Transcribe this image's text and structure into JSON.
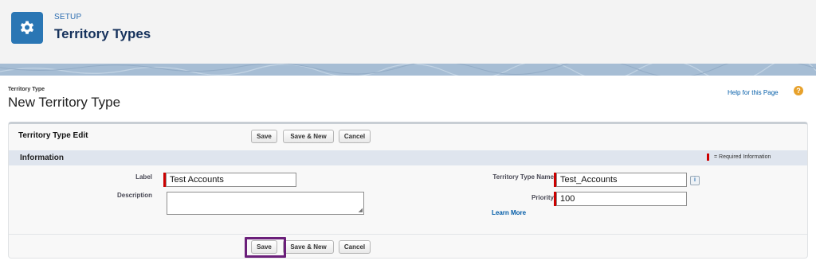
{
  "header": {
    "eyebrow": "SETUP",
    "title": "Territory Types",
    "icon": "gear-icon",
    "accent_color": "#2a76b4"
  },
  "page": {
    "type_label": "Territory Type",
    "title": "New Territory Type",
    "help_link": "Help for this Page",
    "help_icon": "question-icon"
  },
  "edit_block": {
    "title": "Territory Type Edit",
    "buttons": {
      "save": "Save",
      "save_new": "Save & New",
      "cancel": "Cancel"
    }
  },
  "section": {
    "title": "Information",
    "required_legend": "= Required Information"
  },
  "fields": {
    "label": {
      "label": "Label",
      "value": "Test Accounts",
      "required": true
    },
    "description": {
      "label": "Description",
      "value": ""
    },
    "type_name": {
      "label": "Territory Type Name",
      "value": "Test_Accounts",
      "required": true,
      "info_icon": "info-icon"
    },
    "priority": {
      "label": "Priority",
      "value": "100",
      "required": true,
      "link": "Learn More"
    }
  },
  "colors": {
    "required": "#cc0000",
    "link": "#015ba7",
    "highlight": "#6b1f7a"
  }
}
